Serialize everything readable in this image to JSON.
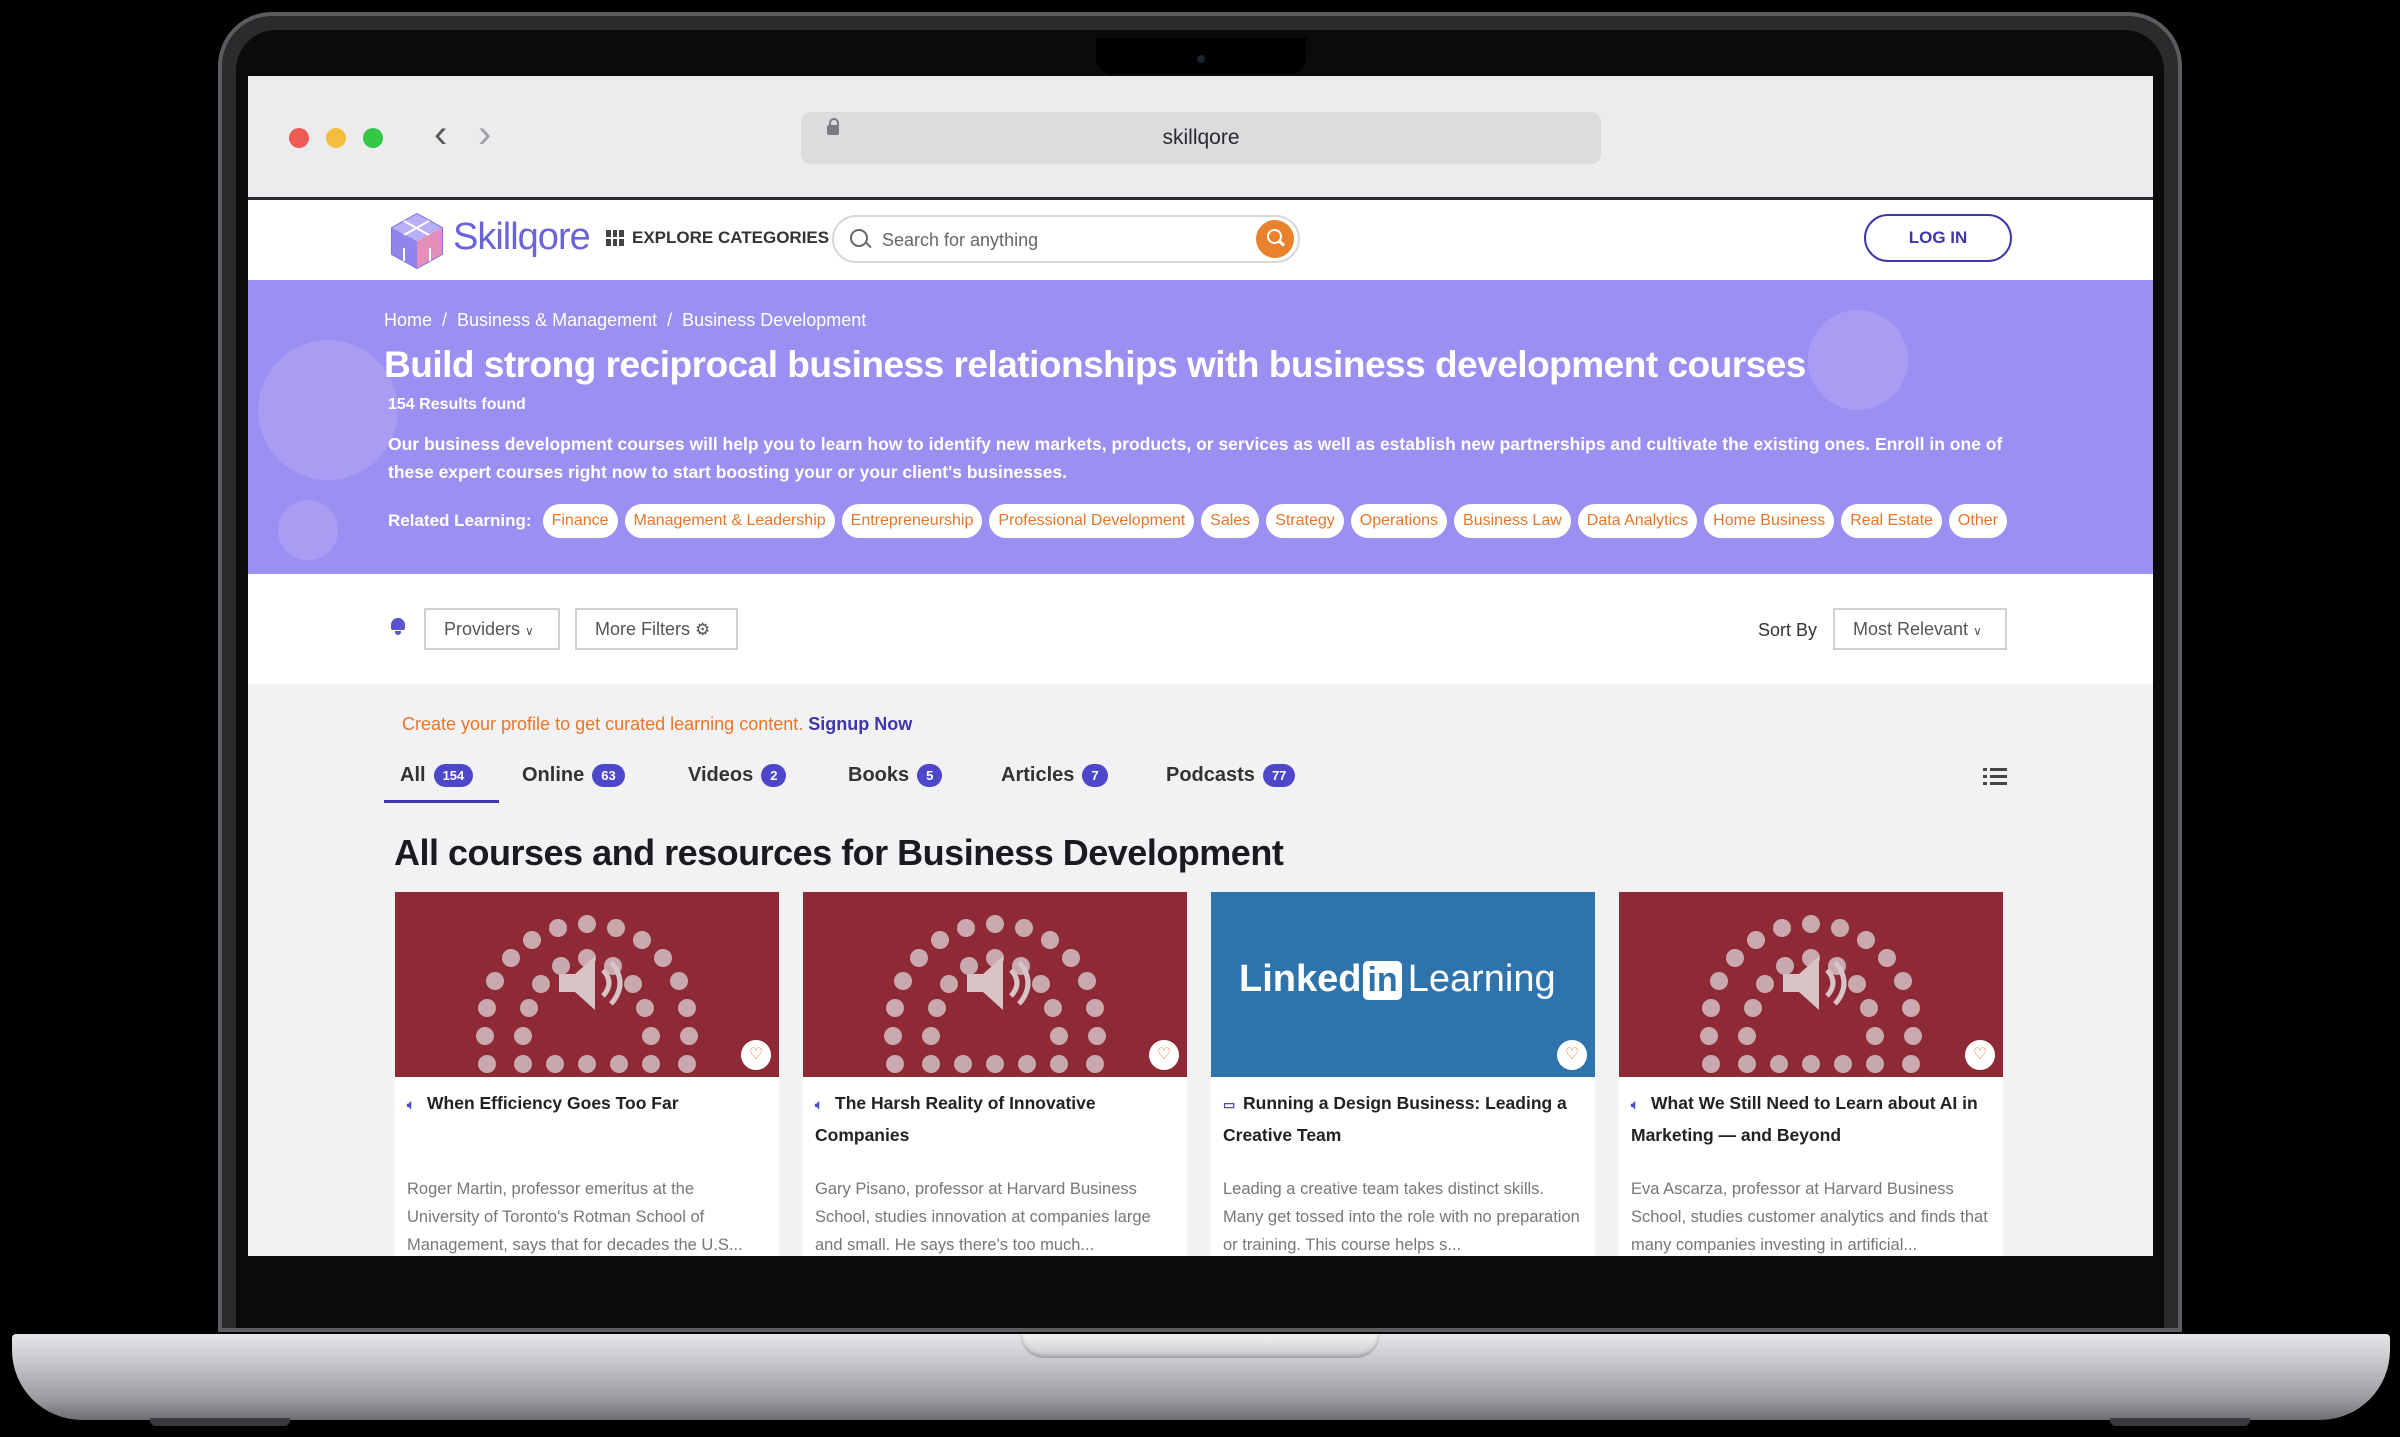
{
  "browser": {
    "url": "skillqore"
  },
  "header": {
    "logo_text": "Skillqore",
    "explore_label": "EXPLORE CATEGORIES",
    "search_placeholder": "Search for anything",
    "login_label": "LOG IN"
  },
  "hero": {
    "breadcrumb": [
      "Home",
      "Business & Management",
      "Business Development"
    ],
    "title": "Build strong reciprocal business relationships with business development courses",
    "results": "154 Results found",
    "description": "Our business development courses will help you to learn how to identify new markets, products, or services as well as establish new partnerships and cultivate the existing ones. Enroll in one of these expert courses right now to start boosting your or your client's businesses.",
    "related_label": "Related Learning:",
    "related_chips": [
      "Finance",
      "Management & Leadership",
      "Entrepreneurship",
      "Professional Development",
      "Sales",
      "Strategy",
      "Operations",
      "Business Law",
      "Data Analytics",
      "Home Business",
      "Real Estate",
      "Other"
    ]
  },
  "filters": {
    "providers_label": "Providers",
    "more_filters_label": "More Filters",
    "sort_by_label": "Sort By",
    "sort_value": "Most Relevant"
  },
  "promo": {
    "text": "Create your profile to get curated learning content.",
    "link": "Signup Now"
  },
  "tabs": [
    {
      "label": "All",
      "count": "154"
    },
    {
      "label": "Online",
      "count": "63"
    },
    {
      "label": "Videos",
      "count": "2"
    },
    {
      "label": "Books",
      "count": "5"
    },
    {
      "label": "Articles",
      "count": "7"
    },
    {
      "label": "Podcasts",
      "count": "77"
    }
  ],
  "section_title": "All courses and resources for Business Development",
  "cards": [
    {
      "type_icon": "speaker-icon",
      "image": "podcast",
      "title": "When Efficiency Goes Too Far",
      "description": "Roger Martin, professor emeritus at the University of Toronto's Rotman School of Management, says that for decades the U.S..."
    },
    {
      "type_icon": "speaker-icon",
      "image": "podcast",
      "title": "The Harsh Reality of Innovative Companies",
      "description": "Gary Pisano, professor at Harvard Business School, studies innovation at companies large and small. He says there's too much..."
    },
    {
      "type_icon": "laptop-icon",
      "image": "linkedin-learning",
      "image_text_1": "Linked",
      "image_text_2": "in",
      "image_text_3": "Learning",
      "title": "Running a Design Business: Leading a Creative Team",
      "description": "Leading a creative team takes distinct skills. Many get tossed into the role with no preparation or training. This course helps s..."
    },
    {
      "type_icon": "speaker-icon",
      "image": "podcast",
      "title": "What We Still Need to Learn about AI in Marketing — and Beyond",
      "description": "Eva Ascarza, professor at Harvard Business School, studies customer analytics and finds that many companies investing in artificial..."
    }
  ],
  "colors": {
    "brand_purple": "#3d37a8",
    "hero_bg": "#9c8ff2",
    "accent_orange": "#e5762a",
    "podcast_red": "#8e2a35",
    "linkedin_blue": "#2f73ad"
  }
}
